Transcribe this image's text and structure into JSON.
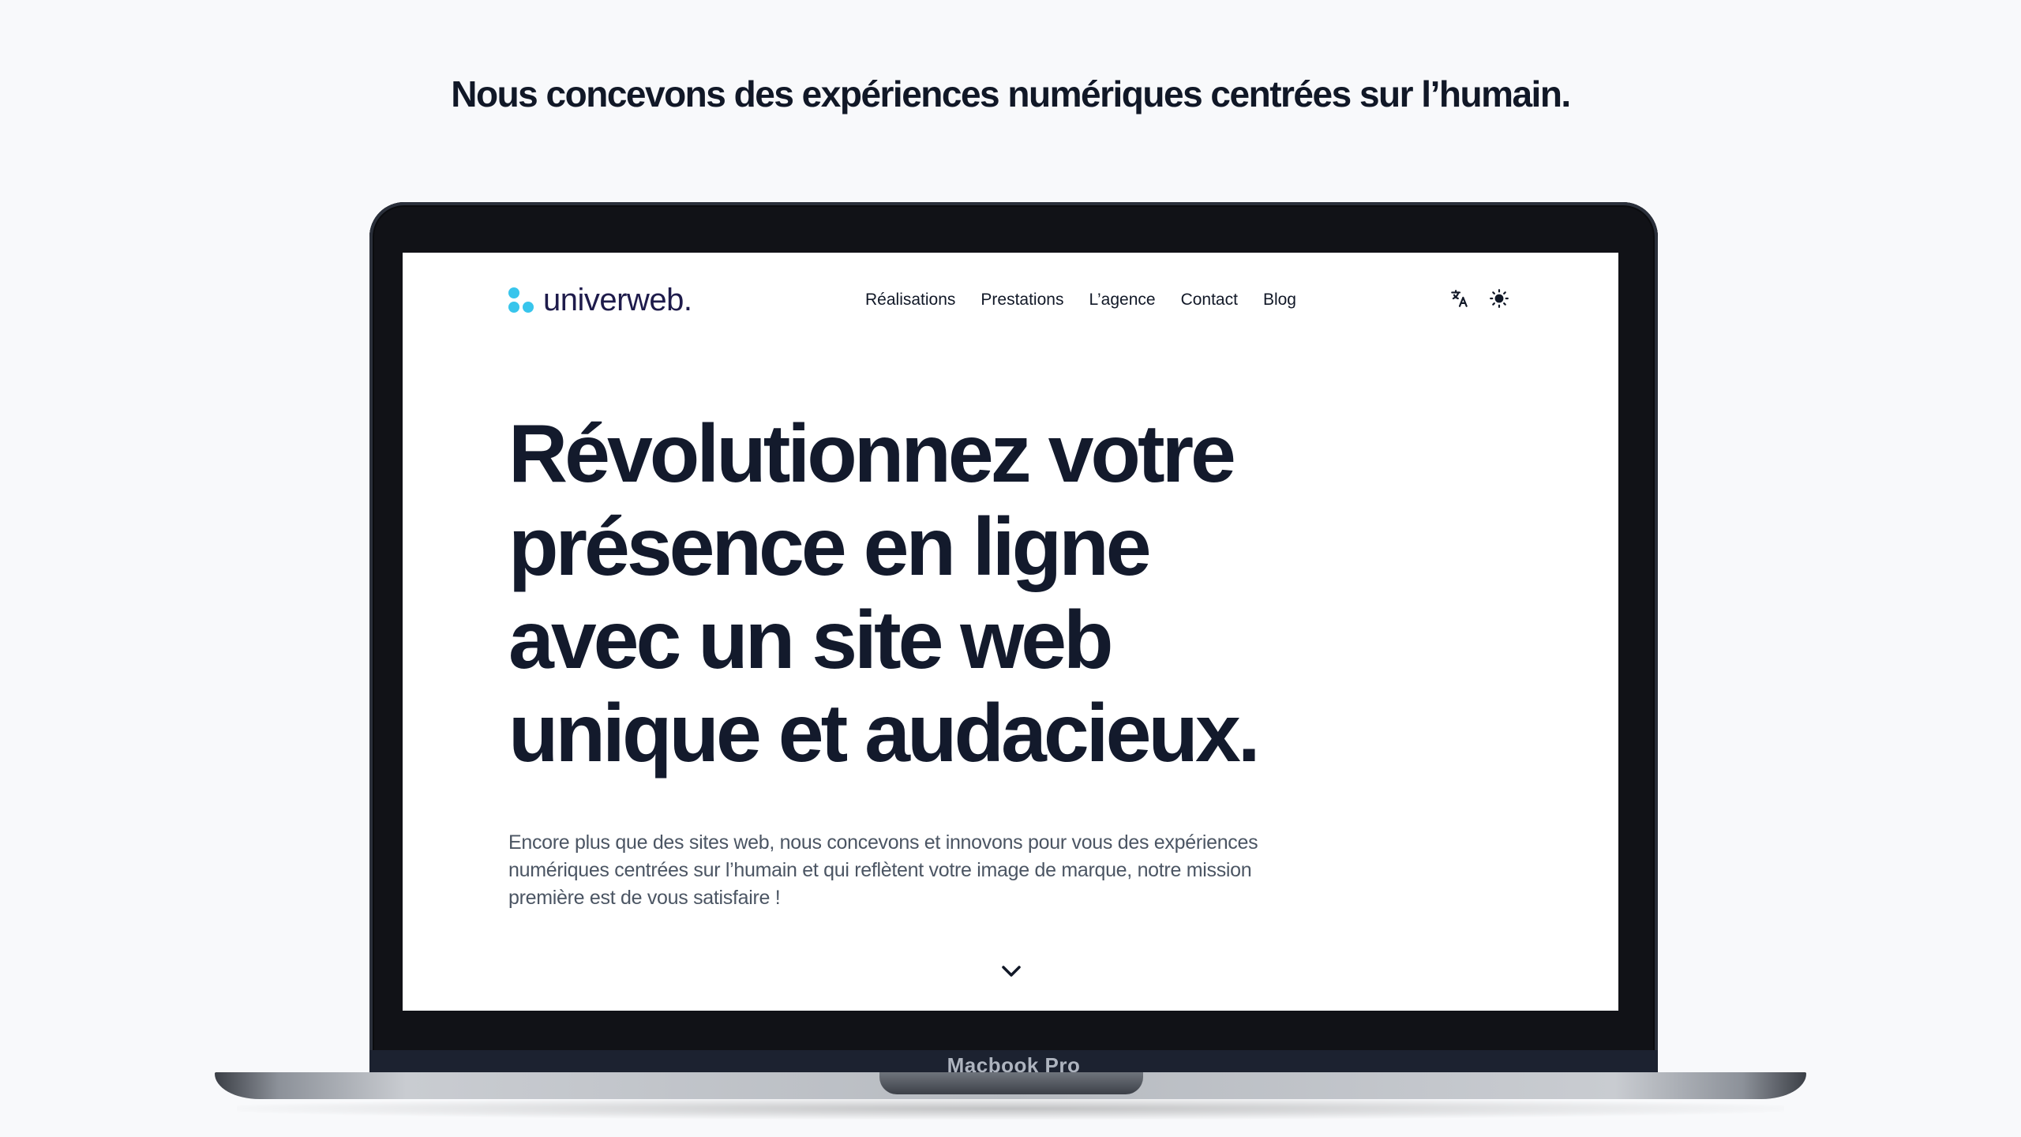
{
  "tagline": "Nous concevons des expériences numériques centrées sur l’humain.",
  "device": {
    "label": "Macbook Pro"
  },
  "site": {
    "logo_text": "univerweb.",
    "colors": {
      "accent": "#38c5ec",
      "logo_text": "#1e1b4b",
      "heading": "#131a2c",
      "body_text": "#4b5563"
    },
    "nav": [
      {
        "label": "Réalisations"
      },
      {
        "label": "Prestations"
      },
      {
        "label": "L’agence"
      },
      {
        "label": "Contact"
      },
      {
        "label": "Blog"
      }
    ],
    "icons": {
      "language": "translate-icon",
      "theme": "sun-icon",
      "scroll": "chevron-down-icon"
    },
    "hero": {
      "title_lines": [
        "Révolutionnez votre",
        "présence en ligne",
        "avec un site web",
        "unique et audacieux."
      ],
      "text": "Encore plus que des sites web, nous concevons et innovons pour vous des expériences numériques centrées sur l’humain et qui reflètent votre image de marque, notre mission première est de vous satisfaire !"
    }
  }
}
